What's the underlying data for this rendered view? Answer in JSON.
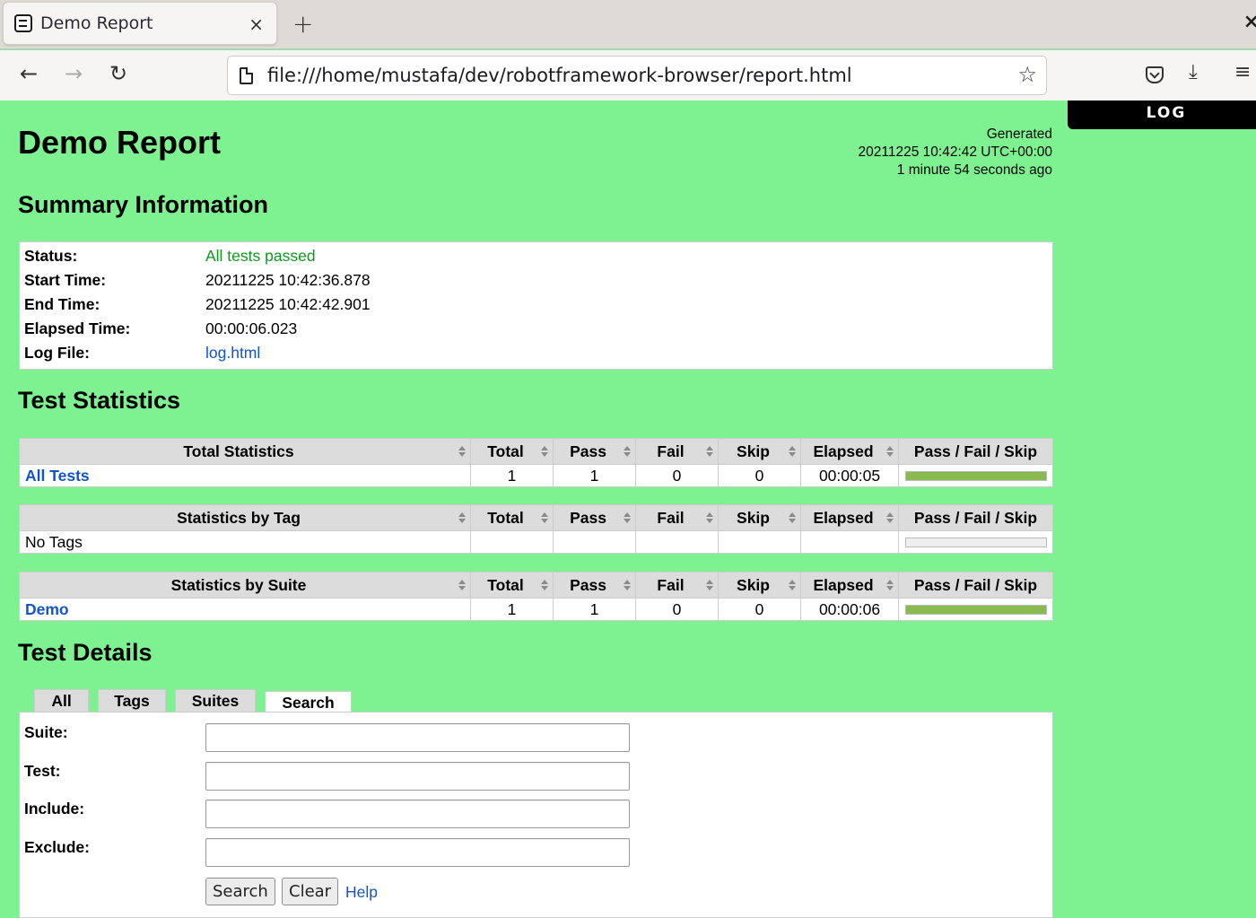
{
  "browser": {
    "tab_title": "Demo Report",
    "tab_close_glyph": "×",
    "new_tab_glyph": "+",
    "window_close_glyph": "×",
    "url": "file:///home/mustafa/dev/robotframework-browser/report.html",
    "back_glyph": "←",
    "forward_glyph": "→",
    "reload_glyph": "↻",
    "star_glyph": "☆",
    "download_glyph": "⤓",
    "menu_glyph": "≡"
  },
  "page": {
    "background_color": "#7ef290",
    "log_button": "LOG",
    "title": "Demo Report",
    "generated": {
      "label": "Generated",
      "timestamp": "20211225 10:42:42 UTC+00:00",
      "ago": "1 minute 54 seconds ago"
    },
    "summary": {
      "heading": "Summary Information",
      "rows": [
        {
          "label": "Status:",
          "value": "All tests passed"
        },
        {
          "label": "Start Time:",
          "value": "20211225 10:42:36.878"
        },
        {
          "label": "End Time:",
          "value": "20211225 10:42:42.901"
        },
        {
          "label": "Elapsed Time:",
          "value": "00:00:06.023"
        },
        {
          "label": "Log File:",
          "value": "log.html"
        }
      ]
    },
    "statistics": {
      "heading": "Test Statistics",
      "columns": [
        "Total",
        "Pass",
        "Fail",
        "Skip",
        "Elapsed",
        "Pass / Fail / Skip"
      ],
      "tables": [
        {
          "title": "Total Statistics",
          "rows": [
            {
              "name": "All Tests",
              "total": "1",
              "pass": "1",
              "fail": "0",
              "skip": "0",
              "elapsed": "00:00:05",
              "pass_pct": 100,
              "fail_pct": 0,
              "skip_pct": 0
            }
          ]
        },
        {
          "title": "Statistics by Tag",
          "rows": [
            {
              "name": "No Tags",
              "total": "",
              "pass": "",
              "fail": "",
              "skip": "",
              "elapsed": "",
              "pass_pct": 0,
              "fail_pct": 0,
              "skip_pct": 0
            }
          ]
        },
        {
          "title": "Statistics by Suite",
          "rows": [
            {
              "name": "Demo",
              "total": "1",
              "pass": "1",
              "fail": "0",
              "skip": "0",
              "elapsed": "00:00:06",
              "pass_pct": 100,
              "fail_pct": 0,
              "skip_pct": 0
            }
          ]
        }
      ]
    },
    "details": {
      "heading": "Test Details",
      "tabs": [
        "All",
        "Tags",
        "Suites",
        "Search"
      ],
      "active_tab": "Search",
      "search": {
        "fields": [
          {
            "label": "Suite:",
            "value": ""
          },
          {
            "label": "Test:",
            "value": ""
          },
          {
            "label": "Include:",
            "value": ""
          },
          {
            "label": "Exclude:",
            "value": ""
          }
        ],
        "search_button": "Search",
        "clear_button": "Clear",
        "help_link": "Help"
      }
    }
  }
}
